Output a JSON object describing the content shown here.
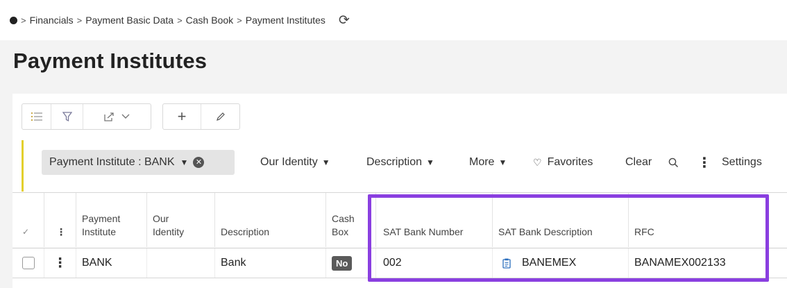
{
  "breadcrumb": {
    "items": [
      "Financials",
      "Payment Basic Data",
      "Cash Book",
      "Payment Institutes"
    ]
  },
  "page": {
    "title": "Payment Institutes"
  },
  "filters": {
    "active_chip": "Payment Institute : BANK",
    "our_identity": "Our Identity",
    "description": "Description",
    "more": "More",
    "favorites": "Favorites",
    "clear": "Clear",
    "settings": "Settings"
  },
  "table": {
    "headers": {
      "payment_institute": "Payment Institute",
      "our_identity": "Our Identity",
      "description": "Description",
      "cash_box": "Cash Box",
      "sat_bank_number": "SAT Bank Number",
      "sat_bank_description": "SAT Bank Description",
      "rfc": "RFC"
    },
    "rows": [
      {
        "payment_institute": "BANK",
        "our_identity": "",
        "description": "Bank",
        "cash_box": "No",
        "sat_bank_number": "002",
        "sat_bank_description": "BANEMEX",
        "rfc": "BANAMEX002133"
      }
    ]
  },
  "colors": {
    "highlight": "#8a3fe0",
    "filter_accent": "#e3cf2d",
    "badge_bg": "#5a5a5a"
  },
  "icons": [
    "home-dot-icon",
    "refresh-icon",
    "list-icon",
    "filter-icon",
    "export-icon",
    "chevron-down-icon",
    "plus-icon",
    "edit-icon",
    "heart-icon",
    "search-icon",
    "kebab-icon",
    "document-icon",
    "checkmark-icon"
  ]
}
